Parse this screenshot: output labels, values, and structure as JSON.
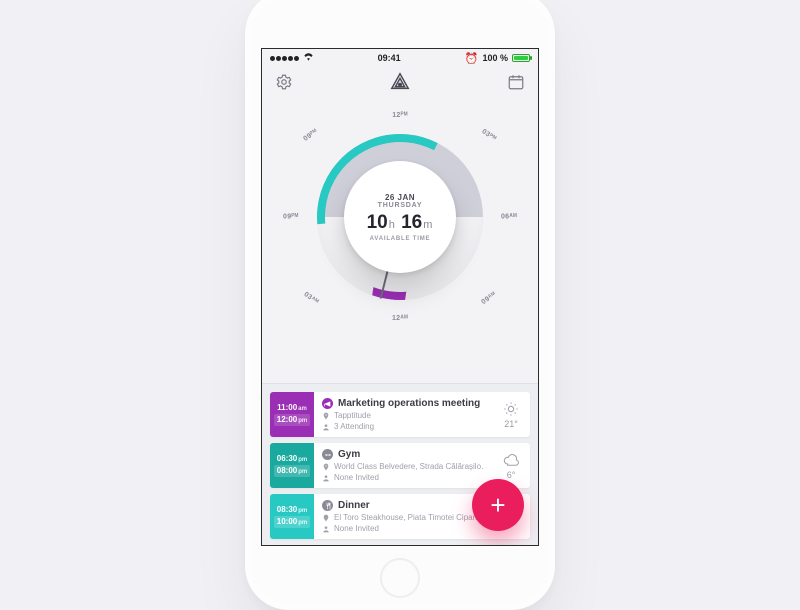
{
  "status": {
    "time": "09:41",
    "battery_pct": "100 %",
    "alarm_icon": "⏰"
  },
  "header": {
    "settings_icon": "gear",
    "calendar_icon": "calendar"
  },
  "dial": {
    "date_line": "26 JAN",
    "dow": "THURSDAY",
    "hours": "10",
    "h_label": "h",
    "minutes": "16",
    "m_label": "m",
    "available_label": "AVAILABLE TIME",
    "ticks": {
      "top": "12ᴾᴹ",
      "right": "03ᴾᴹ",
      "bottom": "12ᴬᴹ",
      "left": "09ᴾᴹ",
      "tr": "06ᴬᴹ",
      "br": "09ᴬᴹ",
      "bl": "03ᴬᴹ",
      "tl": "09ᴾᴹ"
    }
  },
  "events": [
    {
      "color": "purple",
      "start": "11:00",
      "start_ap": "am",
      "end": "12:00",
      "end_ap": "pm",
      "title": "Marketing operations meeting",
      "location": "Tapptitude",
      "attendees": "3 Attending",
      "wx_icon": "sun",
      "temp": "21°"
    },
    {
      "color": "teal",
      "start": "06:30",
      "start_ap": "pm",
      "end": "08:00",
      "end_ap": "pm",
      "title": "Gym",
      "location": "World Class Belvedere, Strada Călărașilo…",
      "attendees": "None Invited",
      "wx_icon": "cloud",
      "temp": "6°"
    },
    {
      "color": "teal",
      "start": "08:30",
      "start_ap": "pm",
      "end": "10:00",
      "end_ap": "pm",
      "title": "Dinner",
      "location": "El Toro Steakhouse, Piata Timotei Cipari…",
      "attendees": "None Invited",
      "wx_icon": "",
      "temp": ""
    }
  ],
  "fab": {
    "label": "+"
  },
  "colors": {
    "purple": "#9a2fb5",
    "teal": "#27c9c2",
    "accent": "#ea1e5d"
  }
}
